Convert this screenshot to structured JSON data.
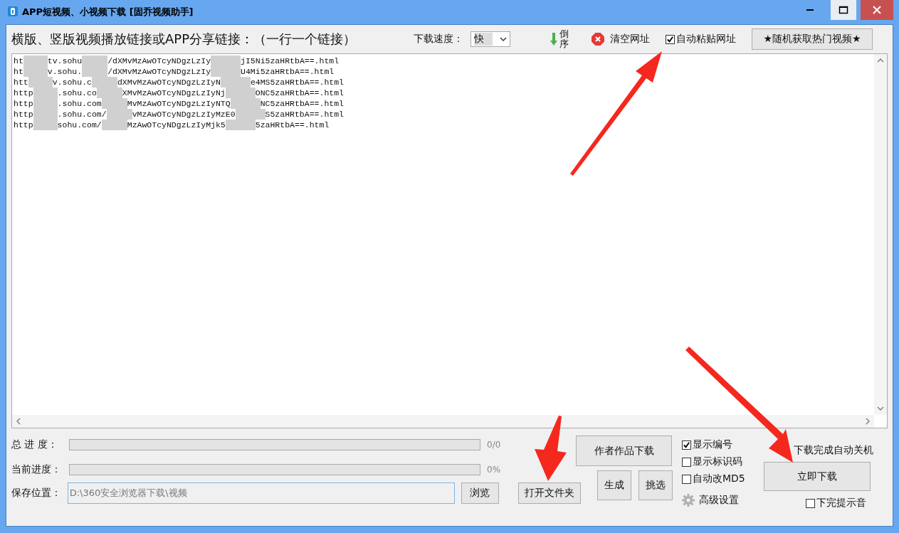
{
  "window": {
    "title": "APP短视频、小视频下载 [固乔视频助手]"
  },
  "toolbar": {
    "label": "横版、竖版视频播放链接或APP分享链接：（一行一个链接）",
    "speed_label": "下载速度：",
    "speed_value": "快",
    "reverse_label": "倒序",
    "clear_label": "清空网址",
    "auto_paste": {
      "label": "自动粘贴网址",
      "checked": true
    },
    "random_button": "★随机获取热门视频★"
  },
  "urls": [
    {
      "segments": [
        "ht",
        "tv.sohu",
        "/dXMvMzAwOTcyNDgzLzIy",
        "jI5Ni5zaHRtbA==.html"
      ]
    },
    {
      "segments": [
        "ht",
        "v.sohu.",
        "/dXMvMzAwOTcyNDgzLzIy",
        "U4Mi5zaHRtbA==.html"
      ]
    },
    {
      "segments": [
        "htt",
        "v.sohu.c",
        "dXMvMzAwOTcyNDgzLzIyN",
        "e4MS5zaHRtbA==.html"
      ]
    },
    {
      "segments": [
        "http",
        ".sohu.co",
        "XMvMzAwOTcyNDgzLzIyNj",
        "ONC5zaHRtbA==.html"
      ]
    },
    {
      "segments": [
        "http",
        ".sohu.com",
        "MvMzAwOTcyNDgzLzIyNTQ",
        "NC5zaHRtbA==.html"
      ]
    },
    {
      "segments": [
        "http",
        ".sohu.com/",
        "vMzAwOTcyNDgzLzIyMzE0",
        "S5zaHRtbA==.html"
      ]
    },
    {
      "segments": [
        "http",
        "sohu.com/",
        "MzAwOTcyNDgzLzIyMjk5",
        "5zaHRtbA==.html"
      ]
    }
  ],
  "progress": [
    {
      "label": "总 进 度：",
      "level": 0,
      "reading": "0/0"
    },
    {
      "label": "当前进度：",
      "level": 0,
      "reading": "0%"
    }
  ],
  "save": {
    "label": "保存位置：",
    "value": "D:\\360安全浏览器下载\\视频",
    "browse_button": "浏览",
    "open_folder_button": "打开文件夹"
  },
  "author_button": "作者作品下载",
  "generate_button": "生成",
  "pick_button": "挑选",
  "options": [
    {
      "label": "显示编号",
      "checked": true
    },
    {
      "label": "显示标识码",
      "checked": false
    },
    {
      "label": "自动改MD5",
      "checked": false
    }
  ],
  "advanced_label": "高级设置",
  "shutdown_label": "下载完成自动关机",
  "download_button": "立即下载",
  "sound": {
    "label": "下完提示音",
    "checked": false
  }
}
